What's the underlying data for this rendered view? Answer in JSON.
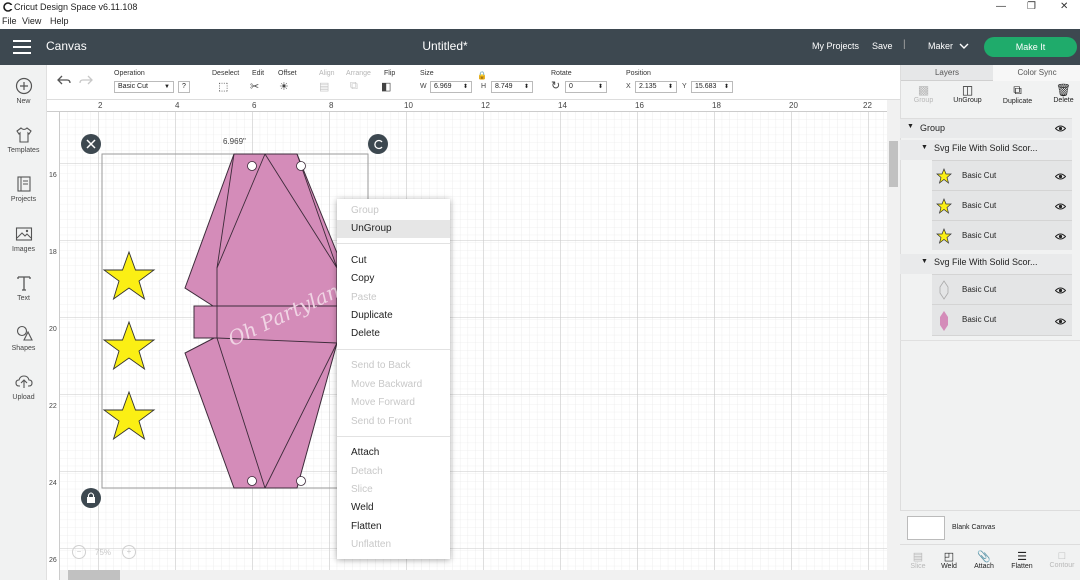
{
  "window": {
    "title": "Cricut Design Space  v6.11.108"
  },
  "menu": {
    "file": "File",
    "view": "View",
    "help": "Help"
  },
  "header": {
    "section": "Canvas",
    "doc_title": "Untitled*",
    "my_projects": "My Projects",
    "save": "Save",
    "separator": "|",
    "machine": "Maker",
    "make_it": "Make It",
    "make_color": "#1fab6b"
  },
  "toolbar": {
    "operation_label": "Operation",
    "operation_value": "Basic Cut",
    "help": "?",
    "deselect": "Deselect",
    "edit": "Edit",
    "offset": "Offset",
    "align": "Align",
    "arrange": "Arrange",
    "flip": "Flip",
    "size": "Size",
    "w_label": "W",
    "w_value": "6.969",
    "h_label": "H",
    "h_value": "8.749",
    "rotate": "Rotate",
    "rotate_value": "0",
    "position": "Position",
    "x_label": "X",
    "x_value": "2.135",
    "y_label": "Y",
    "y_value": "15.683"
  },
  "sidebar": {
    "items": [
      {
        "label": "New",
        "icon": "plus-circle-icon"
      },
      {
        "label": "Templates",
        "icon": "tshirt-icon"
      },
      {
        "label": "Projects",
        "icon": "projects-icon"
      },
      {
        "label": "Images",
        "icon": "images-icon"
      },
      {
        "label": "Text",
        "icon": "text-icon"
      },
      {
        "label": "Shapes",
        "icon": "shapes-icon"
      },
      {
        "label": "Upload",
        "icon": "upload-icon"
      }
    ]
  },
  "rulers": {
    "top": [
      "2",
      "4",
      "6",
      "8",
      "10",
      "12",
      "14",
      "16",
      "18",
      "20",
      "22"
    ],
    "left": [
      "16",
      "18",
      "20",
      "22",
      "24",
      "26"
    ]
  },
  "canvas": {
    "dimension_label": "6.969\"",
    "zoom": "75%",
    "watermark": "Oh Partyland",
    "shape_color": "#d48cb9",
    "star_color": "#fbef14"
  },
  "context_menu": {
    "items": [
      {
        "label": "Group",
        "enabled": false
      },
      {
        "label": "UnGroup",
        "enabled": true
      },
      {
        "label": "Cut",
        "enabled": true
      },
      {
        "label": "Copy",
        "enabled": true
      },
      {
        "label": "Paste",
        "enabled": false
      },
      {
        "label": "Duplicate",
        "enabled": true
      },
      {
        "label": "Delete",
        "enabled": true
      },
      {
        "label": "Send to Back",
        "enabled": false
      },
      {
        "label": "Move Backward",
        "enabled": false
      },
      {
        "label": "Move Forward",
        "enabled": false
      },
      {
        "label": "Send to Front",
        "enabled": false
      },
      {
        "label": "Attach",
        "enabled": true
      },
      {
        "label": "Detach",
        "enabled": false
      },
      {
        "label": "Slice",
        "enabled": false
      },
      {
        "label": "Weld",
        "enabled": true
      },
      {
        "label": "Flatten",
        "enabled": true
      },
      {
        "label": "Unflatten",
        "enabled": false
      }
    ]
  },
  "right_panel": {
    "tabs": [
      "Layers",
      "Color Sync"
    ],
    "actions": [
      {
        "label": "Group",
        "enabled": false
      },
      {
        "label": "UnGroup",
        "enabled": true
      },
      {
        "label": "Duplicate",
        "enabled": true
      },
      {
        "label": "Delete",
        "enabled": true
      }
    ],
    "layers": {
      "group": "Group",
      "subgroup1": "Svg File With Solid Scor...",
      "subgroup1_items": [
        "Basic Cut",
        "Basic Cut",
        "Basic Cut"
      ],
      "subgroup2": "Svg File With Solid Scor...",
      "subgroup2_items": [
        "Basic Cut",
        "Basic Cut"
      ]
    },
    "blank_canvas": "Blank Canvas",
    "bottom_actions": [
      {
        "label": "Slice",
        "enabled": false
      },
      {
        "label": "Weld",
        "enabled": true
      },
      {
        "label": "Attach",
        "enabled": true
      },
      {
        "label": "Flatten",
        "enabled": true
      },
      {
        "label": "Contour",
        "enabled": false
      }
    ]
  }
}
